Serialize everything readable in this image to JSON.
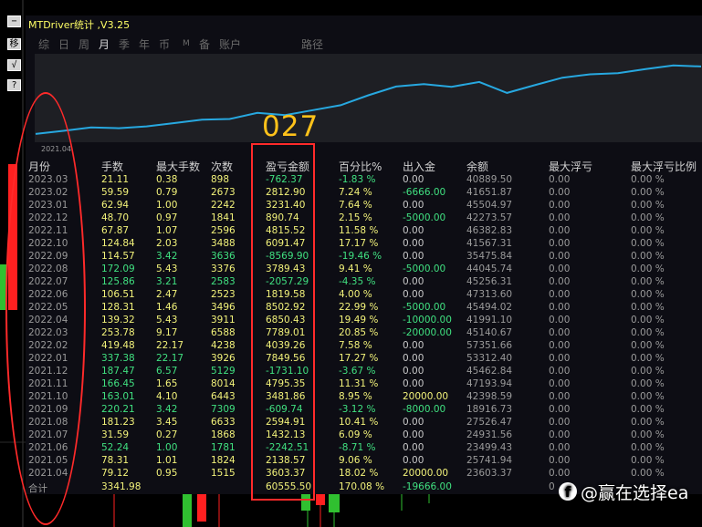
{
  "window": {
    "title": "MTDriver统计 ,V3.25"
  },
  "side_buttons": [
    "−",
    "移",
    "√",
    "?"
  ],
  "tabs": [
    {
      "label": "综"
    },
    {
      "label": "日"
    },
    {
      "label": "周"
    },
    {
      "label": "月",
      "active": true
    },
    {
      "label": "季"
    },
    {
      "label": "年"
    },
    {
      "label": "币"
    },
    {
      "label": "M"
    },
    {
      "label": "备"
    },
    {
      "label": "账户"
    },
    {
      "label": "路径"
    }
  ],
  "equity_curve": {
    "start_label": "2021.04",
    "points": [
      3603.37,
      6079.39,
      8677.14,
      8106.23,
      9538.36,
      12133.27,
      14797.91,
      15317.07,
      20112.42,
      18381.31,
      22229.47,
      26078.75,
      33867.76,
      40718.19,
      42538.01,
      40480.94,
      44270.46,
      35700.56,
      41791.8,
      47606.32,
      50208.17,
      51098.91,
      54330.31,
      57143.21,
      56380.84
    ]
  },
  "overlay_number": "027",
  "table": {
    "headers": [
      "月份",
      "手数",
      "最大手数",
      "次数",
      "盈亏金额",
      "百分比%",
      "出入金",
      "余额",
      "最大浮亏",
      "最大浮亏比例"
    ],
    "rows": [
      [
        "2023.03",
        "21.11",
        "0.38",
        "898",
        "-762.37",
        "-1.83 %",
        "0.00",
        "40889.50",
        "0.00",
        "0.00 %"
      ],
      [
        "2023.02",
        "59.59",
        "0.79",
        "2673",
        "2812.90",
        "7.24 %",
        "-6666.00",
        "41651.87",
        "0.00",
        "0.00 %"
      ],
      [
        "2023.01",
        "62.94",
        "1.00",
        "2242",
        "3231.40",
        "7.64 %",
        "0.00",
        "45504.97",
        "0.00",
        "0.00 %"
      ],
      [
        "2022.12",
        "48.70",
        "0.97",
        "1841",
        "890.74",
        "2.15 %",
        "-5000.00",
        "42273.57",
        "0.00",
        "0.00 %"
      ],
      [
        "2022.11",
        "67.87",
        "1.07",
        "2596",
        "4815.52",
        "11.58 %",
        "0.00",
        "46382.83",
        "0.00",
        "0.00 %"
      ],
      [
        "2022.10",
        "124.84",
        "2.03",
        "3488",
        "6091.47",
        "17.17 %",
        "0.00",
        "41567.31",
        "0.00",
        "0.00 %"
      ],
      [
        "2022.09",
        "114.57",
        "3.42",
        "3636",
        "-8569.90",
        "-19.46 %",
        "0.00",
        "35475.84",
        "0.00",
        "0.00 %"
      ],
      [
        "2022.08",
        "172.09",
        "5.43",
        "3376",
        "3789.43",
        "9.41 %",
        "-5000.00",
        "44045.74",
        "0.00",
        "0.00 %"
      ],
      [
        "2022.07",
        "125.86",
        "3.21",
        "2583",
        "-2057.29",
        "-4.35 %",
        "0.00",
        "45256.31",
        "0.00",
        "0.00 %"
      ],
      [
        "2022.06",
        "106.51",
        "2.47",
        "2523",
        "1819.58",
        "4.00 %",
        "0.00",
        "47313.60",
        "0.00",
        "0.00 %"
      ],
      [
        "2022.05",
        "128.31",
        "1.46",
        "3496",
        "8502.92",
        "22.99 %",
        "-5000.00",
        "45494.02",
        "0.00",
        "0.00 %"
      ],
      [
        "2022.04",
        "139.32",
        "5.43",
        "3911",
        "6850.43",
        "19.49 %",
        "-10000.00",
        "41991.10",
        "0.00",
        "0.00 %"
      ],
      [
        "2022.03",
        "253.78",
        "9.17",
        "6588",
        "7789.01",
        "20.85 %",
        "-20000.00",
        "45140.67",
        "0.00",
        "0.00 %"
      ],
      [
        "2022.02",
        "419.48",
        "22.17",
        "4238",
        "4039.26",
        "7.58 %",
        "0.00",
        "57351.66",
        "0.00",
        "0.00 %"
      ],
      [
        "2022.01",
        "337.38",
        "22.17",
        "3926",
        "7849.56",
        "17.27 %",
        "0.00",
        "53312.40",
        "0.00",
        "0.00 %"
      ],
      [
        "2021.12",
        "187.47",
        "6.57",
        "5129",
        "-1731.10",
        "-3.67 %",
        "0.00",
        "45462.84",
        "0.00",
        "0.00 %"
      ],
      [
        "2021.11",
        "166.45",
        "1.65",
        "8014",
        "4795.35",
        "11.31 %",
        "0.00",
        "47193.94",
        "0.00",
        "0.00 %"
      ],
      [
        "2021.10",
        "163.01",
        "4.10",
        "6443",
        "3481.86",
        "8.95 %",
        "20000.00",
        "42398.59",
        "0.00",
        "0.00 %"
      ],
      [
        "2021.09",
        "220.21",
        "3.42",
        "7309",
        "-609.74",
        "-3.12 %",
        "-8000.00",
        "18916.73",
        "0.00",
        "0.00 %"
      ],
      [
        "2021.08",
        "181.23",
        "3.45",
        "6633",
        "2594.91",
        "10.41 %",
        "0.00",
        "27526.47",
        "0.00",
        "0.00 %"
      ],
      [
        "2021.07",
        "31.59",
        "0.27",
        "1868",
        "1432.13",
        "6.09 %",
        "0.00",
        "24931.56",
        "0.00",
        "0.00 %"
      ],
      [
        "2021.06",
        "52.24",
        "1.00",
        "1781",
        "-2242.51",
        "-8.71 %",
        "0.00",
        "23499.43",
        "0.00",
        "0.00 %"
      ],
      [
        "2021.05",
        "78.31",
        "1.01",
        "1824",
        "2138.57",
        "9.06 %",
        "0.00",
        "25741.94",
        "0.00",
        "0.00 %"
      ],
      [
        "2021.04",
        "79.12",
        "0.95",
        "1515",
        "3603.37",
        "18.02 %",
        "20000.00",
        "23603.37",
        "0.00",
        "0.00 %"
      ]
    ],
    "total": [
      "合计",
      "3341.98",
      "",
      "",
      "60555.50",
      "170.08 %",
      "-19666.00",
      "",
      "0",
      ""
    ]
  },
  "watermark": {
    "logo": "f",
    "text": "@赢在选择ea"
  },
  "colors": {
    "positive": "#f2f27a",
    "negative": "#40e080",
    "annotation": "#ff2a2a",
    "curve": "#27a8e0",
    "overlay": "#ffc21a"
  }
}
